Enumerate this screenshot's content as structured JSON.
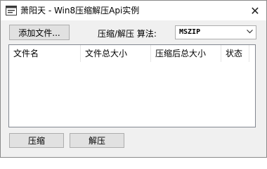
{
  "window": {
    "title": "萧阳天 - Win8压缩解压Api实例",
    "close_label": "✕"
  },
  "toolbar": {
    "add_file_label": "添加文件...",
    "algorithm_label": "压缩/解压 算法:",
    "algorithm_value": "MSZIP"
  },
  "file_list": {
    "columns": [
      "文件名",
      "文件总大小",
      "压缩后总大小",
      "状态"
    ],
    "rows": []
  },
  "actions": {
    "compress_label": "压缩",
    "decompress_label": "解压"
  }
}
